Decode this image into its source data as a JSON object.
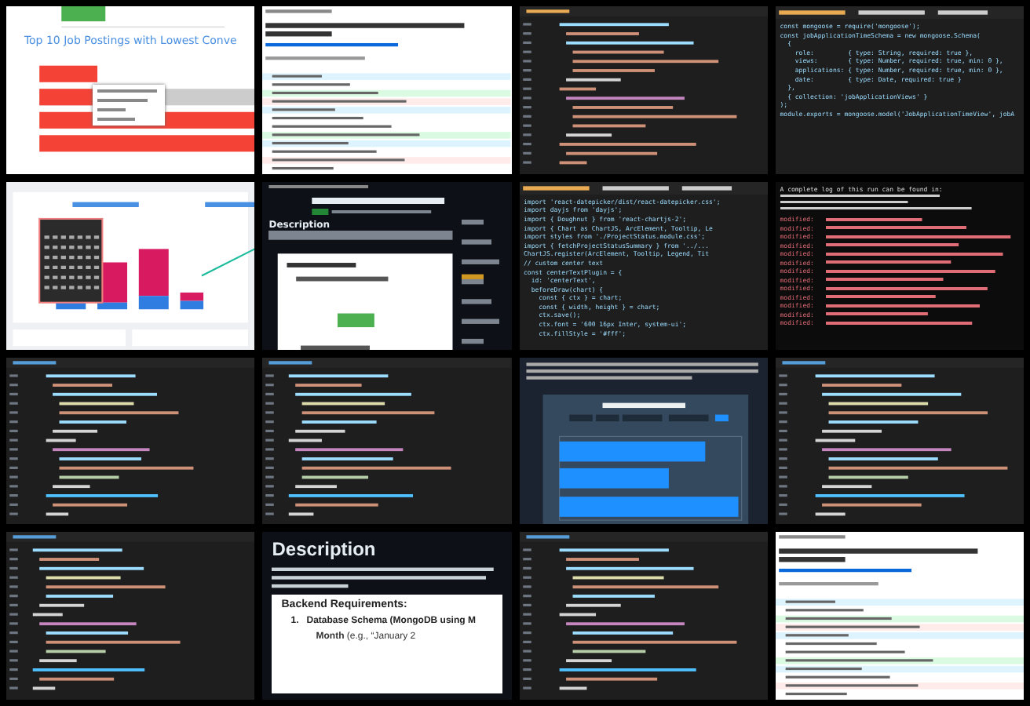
{
  "tiles": [
    {
      "kind": "bar-chart",
      "title": "Top 10 Job Postings with Lowest Conve"
    },
    {
      "kind": "diff-light"
    },
    {
      "kind": "json-editor"
    },
    {
      "kind": "code",
      "lines": [
        "const mongoose = require('mongoose');",
        "const jobApplicationTimeSchema = new mongoose.Schema(",
        "  {",
        "    role:         { type: String, required: true },",
        "    views:        { type: Number, required: true, min: 0 },",
        "    applications: { type: Number, required: true, min: 0 },",
        "    date:         { type: Date, required: true }",
        "  },",
        "  { collection: 'jobApplicationViews' }",
        ");",
        "module.exports = mongoose.model('JobApplicationTimeView', jobA"
      ]
    },
    {
      "kind": "dashboard"
    },
    {
      "kind": "pr-dark",
      "heading": "Description"
    },
    {
      "kind": "code",
      "lines": [
        "import 'react-datepicker/dist/react-datepicker.css';",
        "import dayjs from 'dayjs';",
        "import { Doughnut } from 'react-chartjs-2';",
        "import { Chart as ChartJS, ArcElement, Tooltip, Le",
        "import styles from './ProjectStatus.module.css';",
        "import { fetchProjectStatusSummary } from '../...",
        "ChartJS.register(ArcElement, Tooltip, Legend, Tit",
        "// custom center text",
        "const centerTextPlugin = {",
        "  id: 'centerText',",
        "  beforeDraw(chart) {",
        "    const { ctx } = chart;",
        "    const { width, height } = chart;",
        "    ctx.save();",
        "    ctx.font = '600 16px Inter, system-ui';",
        "    ctx.fillStyle = '#fff';"
      ]
    },
    {
      "kind": "terminal",
      "intro": "A complete log of this run can be found in:",
      "lines": [
        "modified:",
        "modified:",
        "modified:",
        "modified:",
        "modified:",
        "modified:",
        "modified:",
        "modified:",
        "modified:",
        "modified:",
        "modified:",
        "modified:",
        "modified:"
      ]
    },
    {
      "kind": "code"
    },
    {
      "kind": "code"
    },
    {
      "kind": "dark-chart"
    },
    {
      "kind": "code"
    },
    {
      "kind": "code"
    },
    {
      "kind": "doc",
      "heading": "Description",
      "subheading": "Backend Requirements:",
      "number": "1.",
      "item": "Database Schema (MongoDB using M",
      "bullet": "**Month** (e.g., “January 2"
    },
    {
      "kind": "code"
    },
    {
      "kind": "diff-light"
    }
  ]
}
